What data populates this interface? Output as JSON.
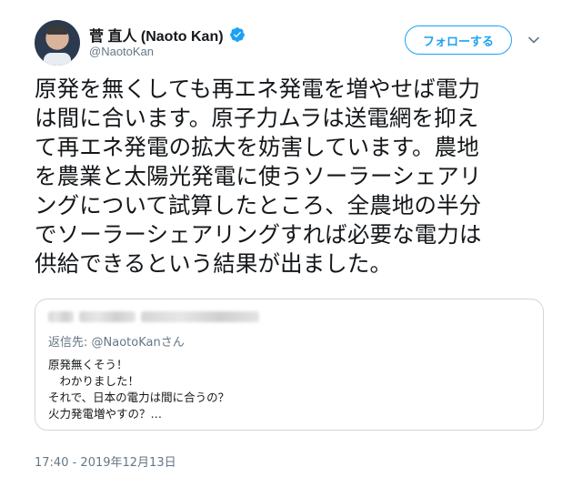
{
  "user": {
    "display_name": "菅 直人 (Naoto Kan)",
    "handle": "@NaotoKan",
    "verified": true
  },
  "follow_button_label": "フォローする",
  "tweet": {
    "lines": [
      "原発を無くしても再エネ発電を増やせば電力",
      "は間に合います。原子力ムラは送電網を抑え",
      "て再エネ発電の拡大を妨害しています。農地",
      "を農業と太陽光発電に使うソーラーシェアリ",
      "ングについて試算したところ、全農地の半分",
      "でソーラーシェアリングすれば必要な電力は",
      "供給できるという結果が出ました。"
    ]
  },
  "quoted_tweet": {
    "reply_prefix": "返信先: ",
    "reply_mention": "@NaotoKanさん",
    "text_lines": [
      "原発無くそう！",
      "　わかりました！",
      "それで、日本の電力は間に合うの？",
      "火力発電増やすの？…"
    ]
  },
  "timestamp": "17:40 - 2019年12月13日",
  "colors": {
    "accent": "#1da1f2",
    "secondary_text": "#657786",
    "border": "#ccd6dd"
  },
  "icons": {
    "verified": "verified-badge-icon",
    "menu": "chevron-down-icon"
  }
}
